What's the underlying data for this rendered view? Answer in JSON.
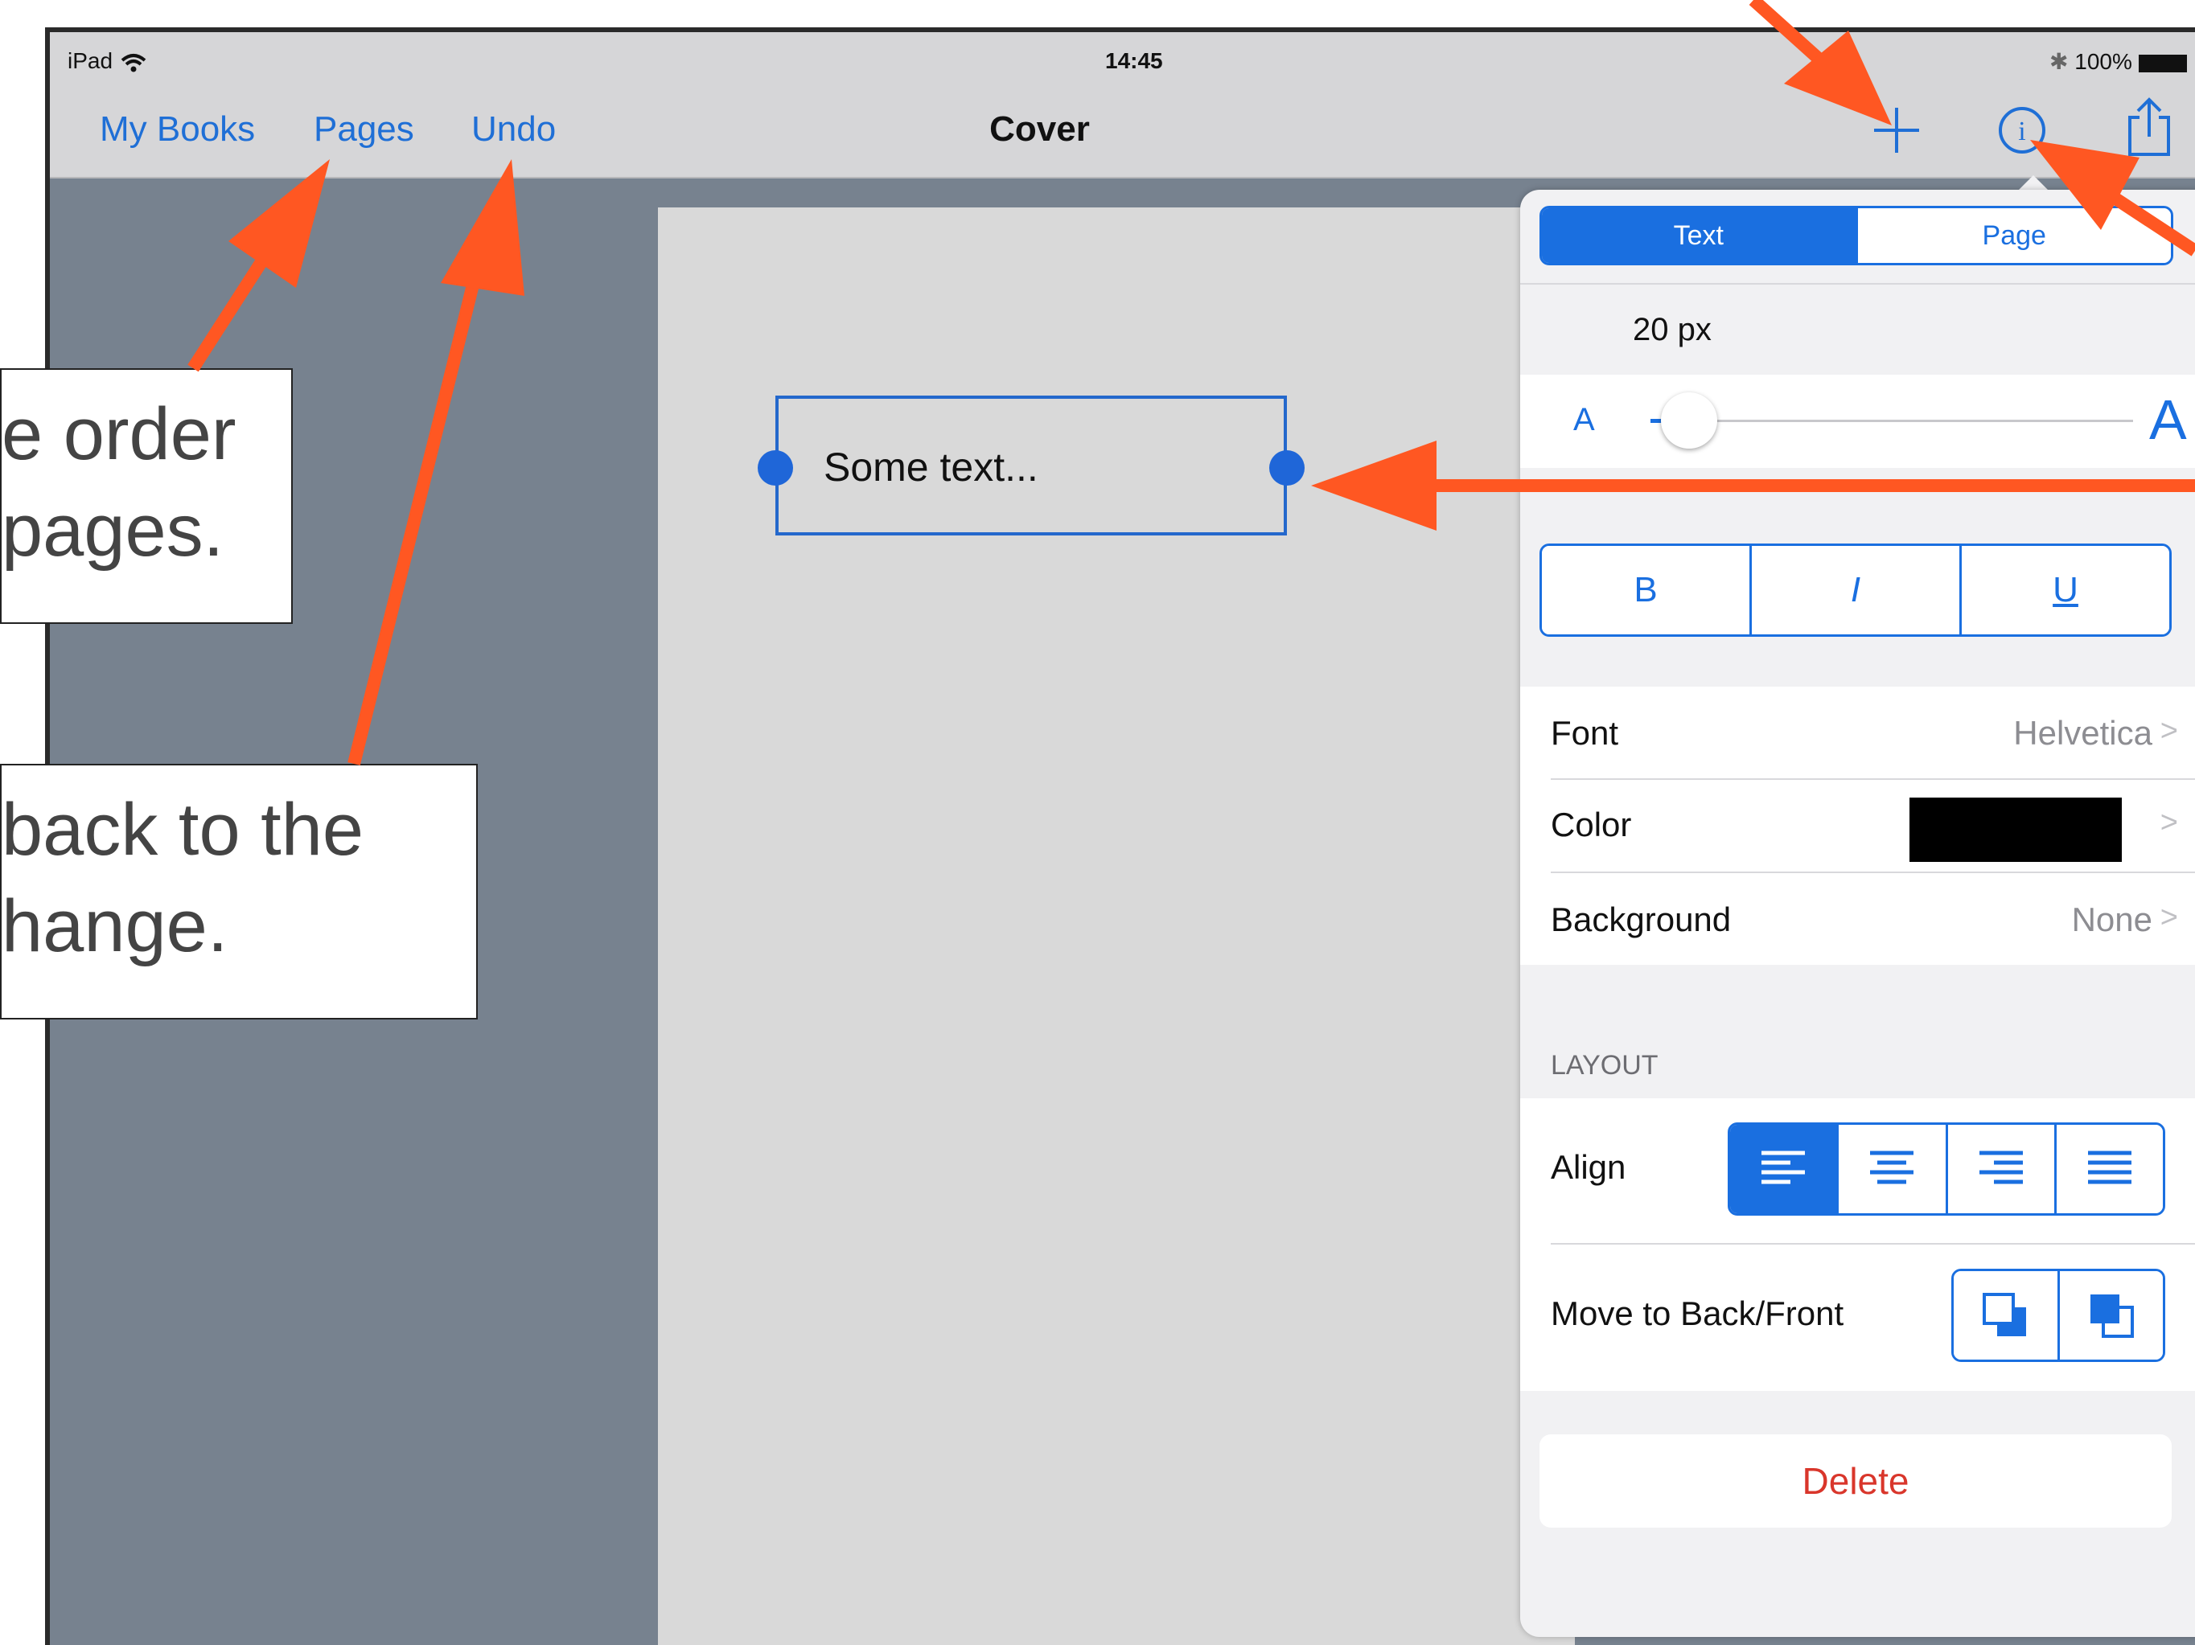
{
  "status_bar": {
    "device": "iPad",
    "time": "14:45",
    "battery": "100%"
  },
  "navbar": {
    "left_links": [
      "My Books",
      "Pages",
      "Undo"
    ],
    "title": "Cover",
    "icons": [
      "plus-icon",
      "info-icon",
      "share-icon"
    ]
  },
  "canvas": {
    "text_box": "Some text..."
  },
  "inspector": {
    "tabs": [
      "Text",
      "Page"
    ],
    "selected_tab": "Text",
    "size_label": "20 px",
    "slider": {
      "min_label": "A",
      "max_label": "A",
      "value_fraction": 0.08
    },
    "style_buttons": [
      "B",
      "I",
      "U"
    ],
    "rows": [
      {
        "label": "Font",
        "value": "Helvetica"
      },
      {
        "label": "Color",
        "value_color": "#000000"
      },
      {
        "label": "Background",
        "value": "None"
      }
    ],
    "section_header": "LAYOUT",
    "align_label": "Align",
    "align_options": [
      "align-left-icon",
      "align-center-icon",
      "align-right-icon",
      "align-justify-icon"
    ],
    "selected_align": "align-left-icon",
    "move_label": "Move to Back/Front",
    "delete_label": "Delete"
  },
  "annotations": {
    "callout1": [
      "e order",
      "pages."
    ],
    "callout2": [
      "back to the",
      "hange."
    ]
  },
  "colors": {
    "accent": "#1a6fe0",
    "arrow": "#ff5722",
    "delete": "#d9362b"
  }
}
